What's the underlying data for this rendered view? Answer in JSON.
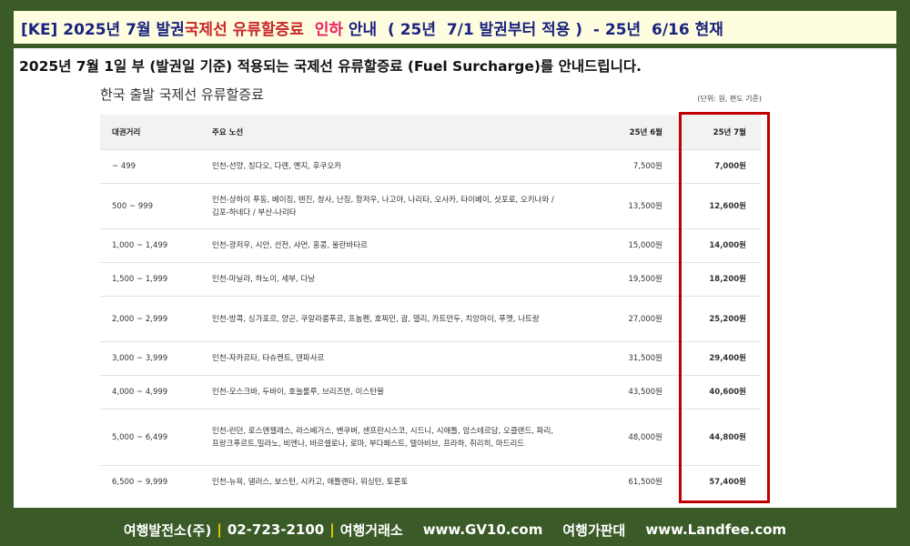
{
  "banner": {
    "part1": "[KE] 2025년 7월  발권  ",
    "part2": "국제선  유류할증료",
    "part3": "  ",
    "part4": "인하",
    "part5": " 안내  ( 25년  7/1 발권부터 적용 )  - 25년  6/16 현재"
  },
  "intro": "2025년 7월 1일 부 (발권일 기준) 적용되는 국제선 유류할증료 (Fuel Surcharge)를 안내드립니다.",
  "table": {
    "title": "한국 출발 국제선 유류할증료",
    "unit": "(단위: 원, 편도 기준)",
    "headers": {
      "distance": "대권거리",
      "routes": "주요 노선",
      "june": "25년 6월",
      "july": "25년 7월"
    },
    "rows": [
      {
        "distance": "~ 499",
        "routes": "인천-선양, 칭다오, 다롄, 옌지, 후쿠오카",
        "june": "7,500원",
        "july": "7,000원"
      },
      {
        "distance": "500 ~ 999",
        "routes": "인천-상하이 푸동, 베이징, 톈진, 창사, 난징, 항저우, 나고야, 나리타, 오사카, 타이베이, 삿포로, 오키나와 / 김포-하네다 / 부산-나리타",
        "june": "13,500원",
        "july": "12,600원"
      },
      {
        "distance": "1,000 ~ 1,499",
        "routes": "인천-광저우, 시안, 선전, 샤먼, 홍콩, 울란바타르",
        "june": "15,000원",
        "july": "14,000원"
      },
      {
        "distance": "1,500 ~ 1,999",
        "routes": "인천-마닐라, 하노이, 세부, 다낭",
        "june": "19,500원",
        "july": "18,200원"
      },
      {
        "distance": "2,000 ~ 2,999",
        "routes": "인천-방콕, 싱가포르, 양곤, 쿠알라룸푸르, 프놈펜, 호찌민, 괌, 델리, 카트만두, 치앙마이, 푸껫, 나트랑",
        "june": "27,000원",
        "july": "25,200원"
      },
      {
        "distance": "3,000 ~ 3,999",
        "routes": "인천-자카르타, 타슈켄트, 덴파사르",
        "june": "31,500원",
        "july": "29,400원"
      },
      {
        "distance": "4,000 ~ 4,999",
        "routes": "인천-모스크바, 두바이, 호놀룰루, 브리즈번, 이스탄불",
        "june": "43,500원",
        "july": "40,600원"
      },
      {
        "distance": "5,000 ~ 6,499",
        "routes": "인천-런던, 로스앤젤레스, 라스베거스, 밴쿠버, 샌프란시스코, 시드니, 시애틀, 암스테르담, 오클랜드, 파리, 프랑크푸르트,밀라노, 비엔나, 바르셀로나, 로마, 부다페스트, 텔아비브, 프라하, 취리히, 마드리드",
        "june": "48,000원",
        "july": "44,800원"
      },
      {
        "distance": "6,500 ~ 9,999",
        "routes": "인천-뉴욕, 댈러스, 보스턴, 시카고, 애틀랜타, 워싱턴, 토론토",
        "june": "61,500원",
        "july": "57,400원"
      }
    ]
  },
  "footer": {
    "company": "여행발전소(주)",
    "sep1": "|",
    "phone": "02-723-2100",
    "sep2": "|",
    "agency": "여행거래소",
    "site1": "www.GV10.com",
    "market": "여행가판대",
    "site2": "www.Landfee.com"
  },
  "colors": {
    "page_background": "#3a5a27",
    "banner_background": "#fffde0",
    "banner_text": "#1a237e",
    "banner_red": "#c62828",
    "banner_pink": "#e91e63",
    "highlight_border": "#c00000",
    "footer_separator": "#ffd400"
  }
}
